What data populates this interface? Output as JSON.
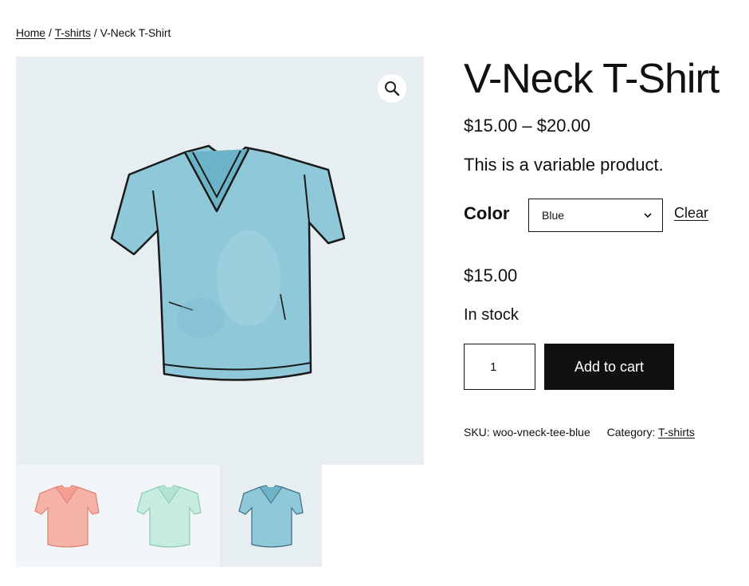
{
  "breadcrumb": {
    "home": "Home",
    "sep1": "/",
    "category": "T-shirts",
    "sep2": "/",
    "current": "V-Neck T-Shirt"
  },
  "gallery": {
    "zoom_icon": "magnifier-icon",
    "main_color": "#8fc8d8",
    "thumbnails": [
      {
        "color": "#f5b3a8",
        "label": "pink-shirt"
      },
      {
        "color": "#c6ece0",
        "label": "mint-shirt"
      },
      {
        "color": "#8fc8d8",
        "label": "blue-shirt"
      }
    ]
  },
  "product": {
    "title": "V-Neck T-Shirt",
    "price_range": "$15.00 – $20.00",
    "description": "This is a variable product.",
    "variation": {
      "label": "Color",
      "selected": "Blue",
      "clear": "Clear"
    },
    "variation_price": "$15.00",
    "stock": "In stock",
    "quantity": "1",
    "add_to_cart": "Add to cart",
    "meta": {
      "sku_label": "SKU:",
      "sku": "woo-vneck-tee-blue",
      "category_label": "Category:",
      "category": "T-shirts"
    }
  }
}
